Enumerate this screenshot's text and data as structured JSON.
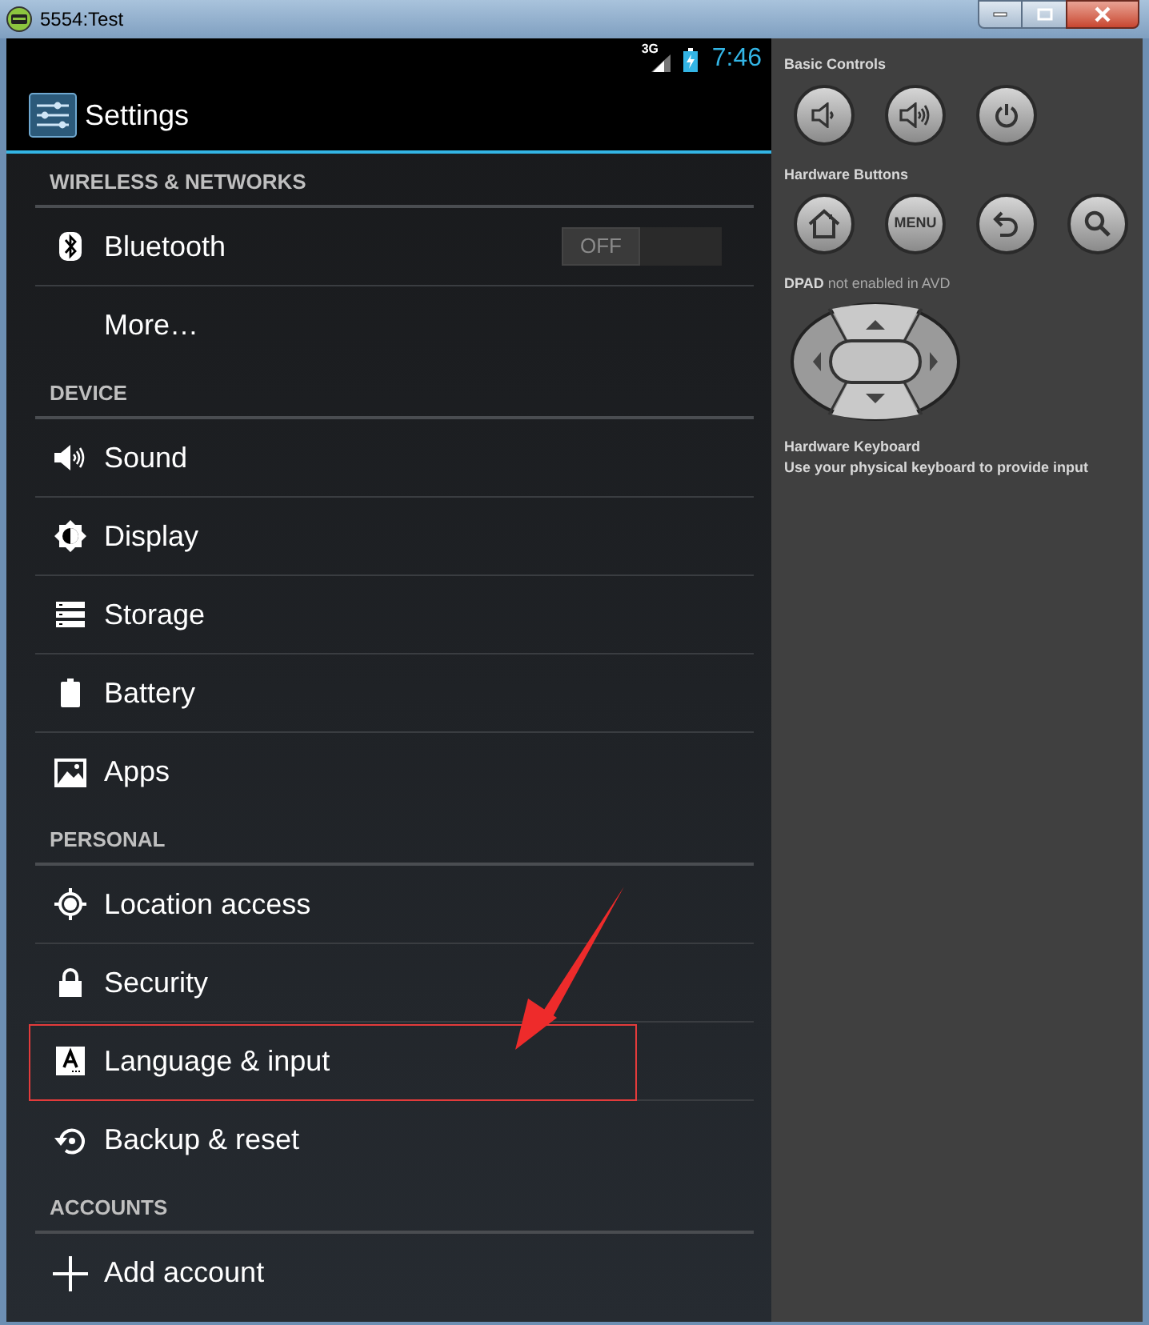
{
  "window": {
    "title": "5554:Test"
  },
  "status_bar": {
    "network": "3G",
    "time": "7:46"
  },
  "action_bar": {
    "title": "Settings"
  },
  "sections": [
    {
      "header": "WIRELESS & NETWORKS",
      "items": [
        {
          "label": "Bluetooth",
          "kind": "toggle",
          "toggle": {
            "label": "OFF",
            "on": false
          },
          "highlighted": false
        },
        {
          "label": "More…",
          "kind": "plain",
          "highlighted": false
        }
      ]
    },
    {
      "header": "DEVICE",
      "items": [
        {
          "label": "Sound",
          "kind": "plain",
          "highlighted": false
        },
        {
          "label": "Display",
          "kind": "plain",
          "highlighted": false
        },
        {
          "label": "Storage",
          "kind": "plain",
          "highlighted": false
        },
        {
          "label": "Battery",
          "kind": "plain",
          "highlighted": false
        },
        {
          "label": "Apps",
          "kind": "plain",
          "highlighted": false
        }
      ]
    },
    {
      "header": "PERSONAL",
      "items": [
        {
          "label": "Location access",
          "kind": "plain",
          "highlighted": false
        },
        {
          "label": "Security",
          "kind": "plain",
          "highlighted": false
        },
        {
          "label": "Language & input",
          "kind": "plain",
          "highlighted": true
        },
        {
          "label": "Backup & reset",
          "kind": "plain",
          "highlighted": false
        }
      ]
    },
    {
      "header": "ACCOUNTS",
      "items": [
        {
          "label": "Add account",
          "kind": "plain",
          "highlighted": false
        }
      ]
    }
  ],
  "controls_panel": {
    "basic_controls": {
      "label": "Basic Controls"
    },
    "hardware_buttons": {
      "label": "Hardware Buttons",
      "menu_label": "MENU"
    },
    "dpad": {
      "label": "**DPAD** not enabled in AVD"
    },
    "keyboard": {
      "label": "Hardware Keyboard",
      "hint": "Use your physical keyboard to provide input"
    }
  }
}
